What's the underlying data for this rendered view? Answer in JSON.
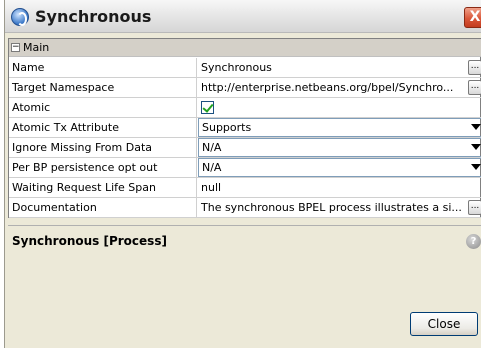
{
  "window": {
    "title": "Synchronous",
    "close_glyph": "X"
  },
  "property_sheet": {
    "category": {
      "toggle": "−",
      "label": "Main"
    },
    "rows": [
      {
        "name": "Name",
        "value": "Synchronous",
        "editor": "text-with-ellipsis"
      },
      {
        "name": "Target Namespace",
        "value": "http://enterprise.netbeans.org/bpel/Synchro...",
        "editor": "text-with-ellipsis"
      },
      {
        "name": "Atomic",
        "value": "",
        "checked": true,
        "editor": "checkbox"
      },
      {
        "name": "Atomic Tx Attribute",
        "value": "Supports",
        "editor": "combo"
      },
      {
        "name": "Ignore Missing From Data",
        "value": "N/A",
        "editor": "combo"
      },
      {
        "name": "Per BP persistence opt out",
        "value": "N/A",
        "editor": "combo"
      },
      {
        "name": "Waiting Request Life Span",
        "value": "null",
        "editor": "text"
      },
      {
        "name": "Documentation",
        "value": "The synchronous BPEL process illustrates a si...",
        "editor": "text-with-ellipsis"
      }
    ],
    "ellipsis_label": "..."
  },
  "description": {
    "title": "Synchronous [Process]",
    "help_glyph": "?"
  },
  "buttons": {
    "close_label": "Close"
  }
}
